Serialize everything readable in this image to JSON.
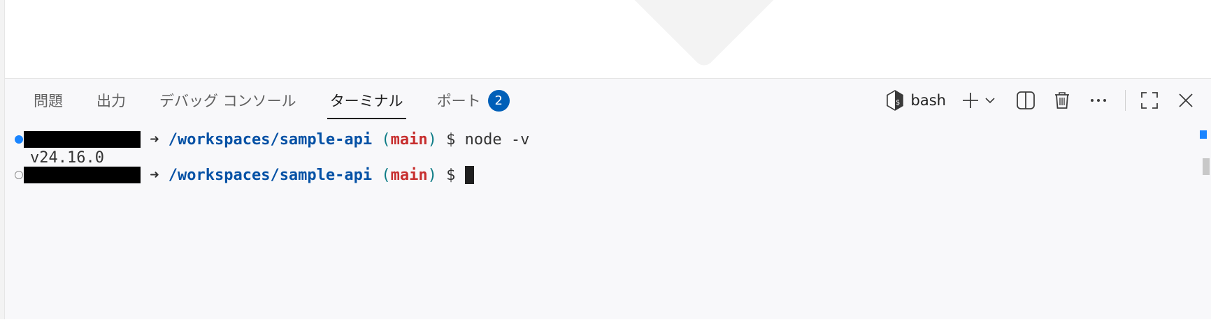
{
  "panel": {
    "tabs": [
      {
        "label": "問題",
        "active": false
      },
      {
        "label": "出力",
        "active": false
      },
      {
        "label": "デバッグ コンソール",
        "active": false
      },
      {
        "label": "ターミナル",
        "active": true
      },
      {
        "label": "ポート",
        "active": false,
        "badge": "2"
      }
    ]
  },
  "toolbar": {
    "shell_label": "bash",
    "icons": [
      "bash-shell-icon",
      "add-icon",
      "chevron-down-icon",
      "split-icon",
      "trash-icon",
      "more-icon",
      "maximize-icon",
      "close-icon"
    ]
  },
  "terminal": {
    "lines": [
      {
        "status": "success",
        "user": "@",
        "arrow": "➜",
        "path": "/workspaces/sample-api",
        "branch": "main",
        "prompt": "$",
        "command": "node -v"
      },
      {
        "output": "v24.16.0"
      },
      {
        "status": "pending",
        "user": "@",
        "arrow": "➜",
        "path": "/workspaces/sample-api",
        "branch": "main",
        "prompt": "$",
        "command": ""
      }
    ]
  },
  "colors": {
    "accent": "#005fb8",
    "path": "#0451a5",
    "branch": "#c72e2e",
    "panel_bg": "#f8f8fa"
  }
}
